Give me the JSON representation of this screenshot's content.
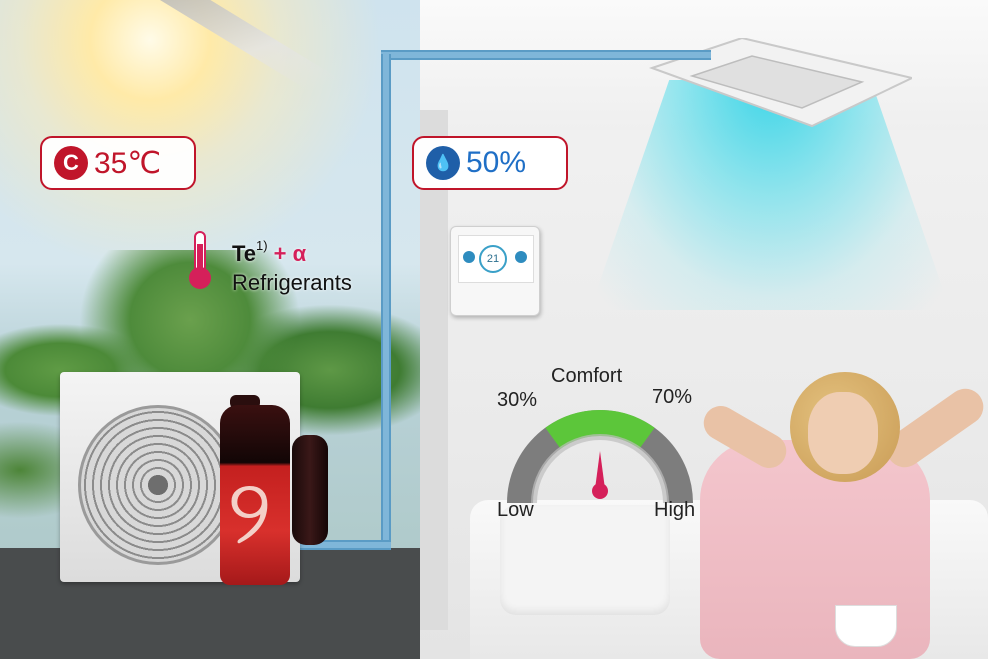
{
  "outdoor": {
    "temperature": "35℃",
    "temperature_icon": "celsius-icon",
    "refrigerant_line1_main": "Te",
    "refrigerant_line1_sup": "1)",
    "refrigerant_line1_extra": "+ α",
    "refrigerant_line2": "Refrigerants",
    "thermometer_icon": "thermometer-icon"
  },
  "indoor": {
    "humidity": "50%",
    "humidity_icon": "water-drop-percent-icon",
    "controller_display": "21"
  },
  "gauge": {
    "title": "Comfort",
    "low_threshold": "30%",
    "high_threshold": "70%",
    "min_label": "Low",
    "max_label": "High",
    "needle_value_percent": 50,
    "colors": {
      "comfort_zone": "#5cc63a",
      "track": "#7d7d7d",
      "needle": "#d5205a"
    }
  },
  "colors": {
    "accent_red": "#c0152a",
    "accent_blue": "#1f6fc6",
    "alpha_pink": "#d5205a"
  }
}
